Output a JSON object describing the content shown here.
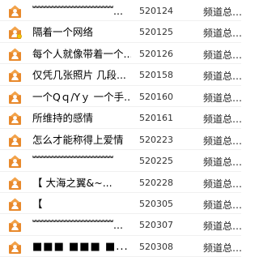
{
  "rows": [
    {
      "title": "﹌﹌﹌﹌﹌﹌﹌﹌...",
      "num": "520124",
      "channel": "频道总…",
      "badge": false,
      "titleClass": "cjk"
    },
    {
      "title": "隔着一个网络",
      "num": "520125",
      "channel": "频道总…",
      "badge": true,
      "titleClass": "cjk"
    },
    {
      "title": "每个人就像带着一个...",
      "num": "520126",
      "channel": "频道总…",
      "badge": false,
      "titleClass": "cjk"
    },
    {
      "title": "仅凭几张照片 几段...",
      "num": "520158",
      "channel": "频道总…",
      "badge": false,
      "titleClass": "cjk"
    },
    {
      "title": "一个Qｑ/Yｙ 一个手...",
      "num": "520160",
      "channel": "频道总…",
      "badge": false,
      "titleClass": "cjk"
    },
    {
      "title": "所维持的感情",
      "num": "520161",
      "channel": "频道总…",
      "badge": false,
      "titleClass": "cjk"
    },
    {
      "title": "怎么才能称得上爱情",
      "num": "520223",
      "channel": "频道总…",
      "badge": false,
      "titleClass": "cjk"
    },
    {
      "title": "﹌﹌﹌﹌﹌﹌﹌﹌",
      "num": "520225",
      "channel": "频道总…",
      "badge": false,
      "titleClass": "cjk"
    },
    {
      "title": "【        大海之翼&~...",
      "num": "520228",
      "channel": "频道总…",
      "badge": false,
      "titleClass": "cjk"
    },
    {
      "title": "【",
      "num": "520305",
      "channel": "频道总…",
      "badge": false,
      "titleClass": "cjk"
    },
    {
      "title": "﹌﹌﹌﹌﹌﹌﹌﹌...",
      "num": "520307",
      "channel": "频道总…",
      "badge": false,
      "titleClass": "cjk"
    },
    {
      "title": "■■■  ■■■  ■...",
      "num": "520308",
      "channel": "频道总…",
      "badge": false,
      "titleClass": "block"
    }
  ]
}
